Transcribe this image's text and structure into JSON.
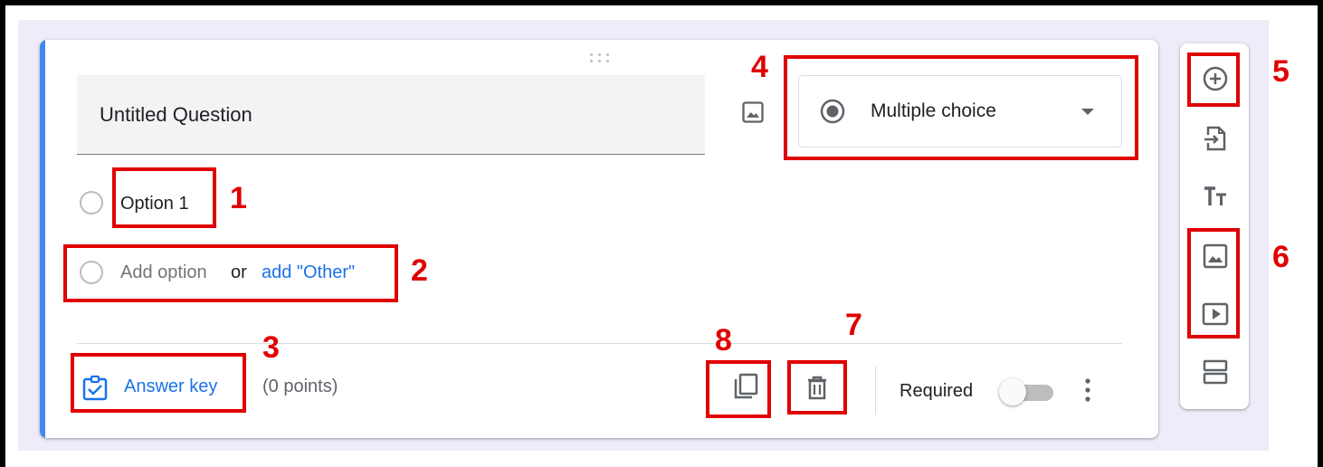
{
  "question": {
    "title": "Untitled Question",
    "type_label": "Multiple choice",
    "options": [
      {
        "label": "Option 1"
      }
    ],
    "add_option_label": "Add option",
    "or_label": "or",
    "add_other_label": "add \"Other\""
  },
  "footer": {
    "answer_key_label": "Answer key",
    "points_label": "(0 points)",
    "required_label": "Required",
    "required_enabled": false
  },
  "toolbar": {
    "items": [
      "add-question-icon",
      "import-questions-icon",
      "add-title-description-icon",
      "add-image-icon",
      "add-video-icon",
      "add-section-icon"
    ]
  },
  "annotations": {
    "labels": [
      "1",
      "2",
      "3",
      "4",
      "5",
      "6",
      "7",
      "8"
    ],
    "color": "#e00000"
  },
  "colors": {
    "accent": "#4285f4",
    "link": "#1a73e8",
    "background": "#f0ebf8"
  }
}
